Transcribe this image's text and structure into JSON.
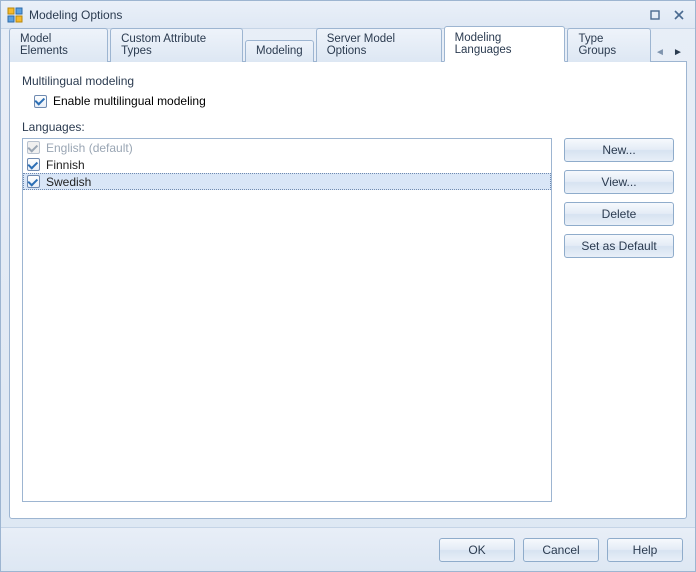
{
  "window": {
    "title": "Modeling Options"
  },
  "tabs": [
    {
      "label": "Model Elements",
      "active": false
    },
    {
      "label": "Custom Attribute Types",
      "active": false
    },
    {
      "label": "Modeling",
      "active": false
    },
    {
      "label": "Server Model Options",
      "active": false
    },
    {
      "label": "Modeling Languages",
      "active": true
    },
    {
      "label": "Type Groups",
      "active": false
    }
  ],
  "group": {
    "title": "Multilingual modeling",
    "enable_label": "Enable multilingual modeling",
    "enable_checked": true,
    "languages_label": "Languages:"
  },
  "languages": [
    {
      "label": "English (default)",
      "checked": true,
      "disabled": true,
      "selected": false
    },
    {
      "label": "Finnish",
      "checked": true,
      "disabled": false,
      "selected": false
    },
    {
      "label": "Swedish",
      "checked": true,
      "disabled": false,
      "selected": true
    }
  ],
  "side_buttons": {
    "new": "New...",
    "view": "View...",
    "delete": "Delete",
    "set_default": "Set as Default"
  },
  "footer": {
    "ok": "OK",
    "cancel": "Cancel",
    "help": "Help"
  }
}
